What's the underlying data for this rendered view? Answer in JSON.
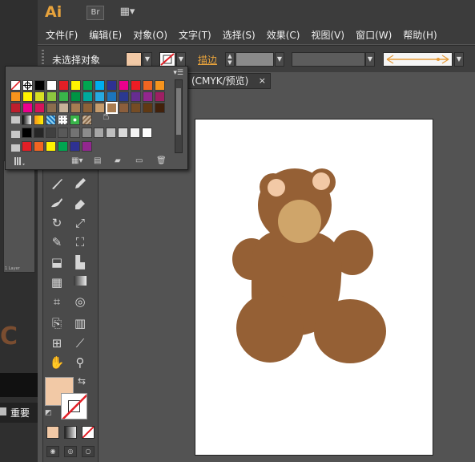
{
  "app": {
    "logo": "Ai",
    "bridge_button": "Br",
    "arrange_button": "▦▾"
  },
  "menu": {
    "items": [
      "文件(F)",
      "编辑(E)",
      "对象(O)",
      "文字(T)",
      "选择(S)",
      "效果(C)",
      "视图(V)",
      "窗口(W)",
      "帮助(H)"
    ]
  },
  "control_bar": {
    "selection_status": "未选择对象",
    "fill_color": "#f2c9a6",
    "stroke_label": "描边",
    "accent_color": "#e8a33c"
  },
  "document": {
    "tab_label": "(CMYK/预览)",
    "close_glyph": "×"
  },
  "left_panel": {
    "layer_caption": "1 Layer",
    "important_label": "重要"
  },
  "swatches": {
    "menu_glyph": "▾☰",
    "row1": [
      "none",
      "register",
      "#000000",
      "#ffffff",
      "#e21f26",
      "#fff200",
      "#00a650",
      "#00aeef",
      "#2e3192",
      "#ec008c",
      "#ed1c24",
      "#f26522",
      "#f7941d"
    ],
    "row2": [
      "#f7941d",
      "#fff200",
      "#d7df23",
      "#8dc63f",
      "#39b54a",
      "#009444",
      "#00a99d",
      "#27aae1",
      "#1c75bc",
      "#2b3990",
      "#662d91",
      "#92278f",
      "#9e1f63"
    ],
    "row3": [
      "#be1e2d",
      "#ec008c",
      "#d4145a",
      "#8b6d4e",
      "#c7b299",
      "#a67c52",
      "#8c6239",
      "#c69c6d",
      "#a97c50",
      "#8b5e3c",
      "#754c24",
      "#603913",
      "#42210b"
    ],
    "row4_gradients": [
      "black-white-gradient",
      "orange-gradient",
      "blue-pattern",
      "dots-pattern",
      "green-pattern",
      "brown-pattern"
    ],
    "row5_grays": [
      "#000000",
      "#262626",
      "#404040",
      "#595959",
      "#737373",
      "#8c8c8c",
      "#a6a6a6",
      "#bfbfbf",
      "#d9d9d9",
      "#f2f2f2",
      "#ffffff"
    ],
    "row6_brights": [
      "#e21f26",
      "#f26522",
      "#fff200",
      "#00a650",
      "#2e3192",
      "#92278f"
    ],
    "selected_index_row3": 8,
    "footer_icons": [
      "library-icon",
      "swatch-kind-icon",
      "swatch-options-icon",
      "new-color-group-icon",
      "new-swatch-icon",
      "delete-swatch-icon"
    ]
  },
  "tools": {
    "fill_color": "#f2c9a6"
  },
  "bear": {
    "body_color": "#956035",
    "muzzle_color": "#cfa56a",
    "ear_inner_color": "#f2c9a6"
  }
}
